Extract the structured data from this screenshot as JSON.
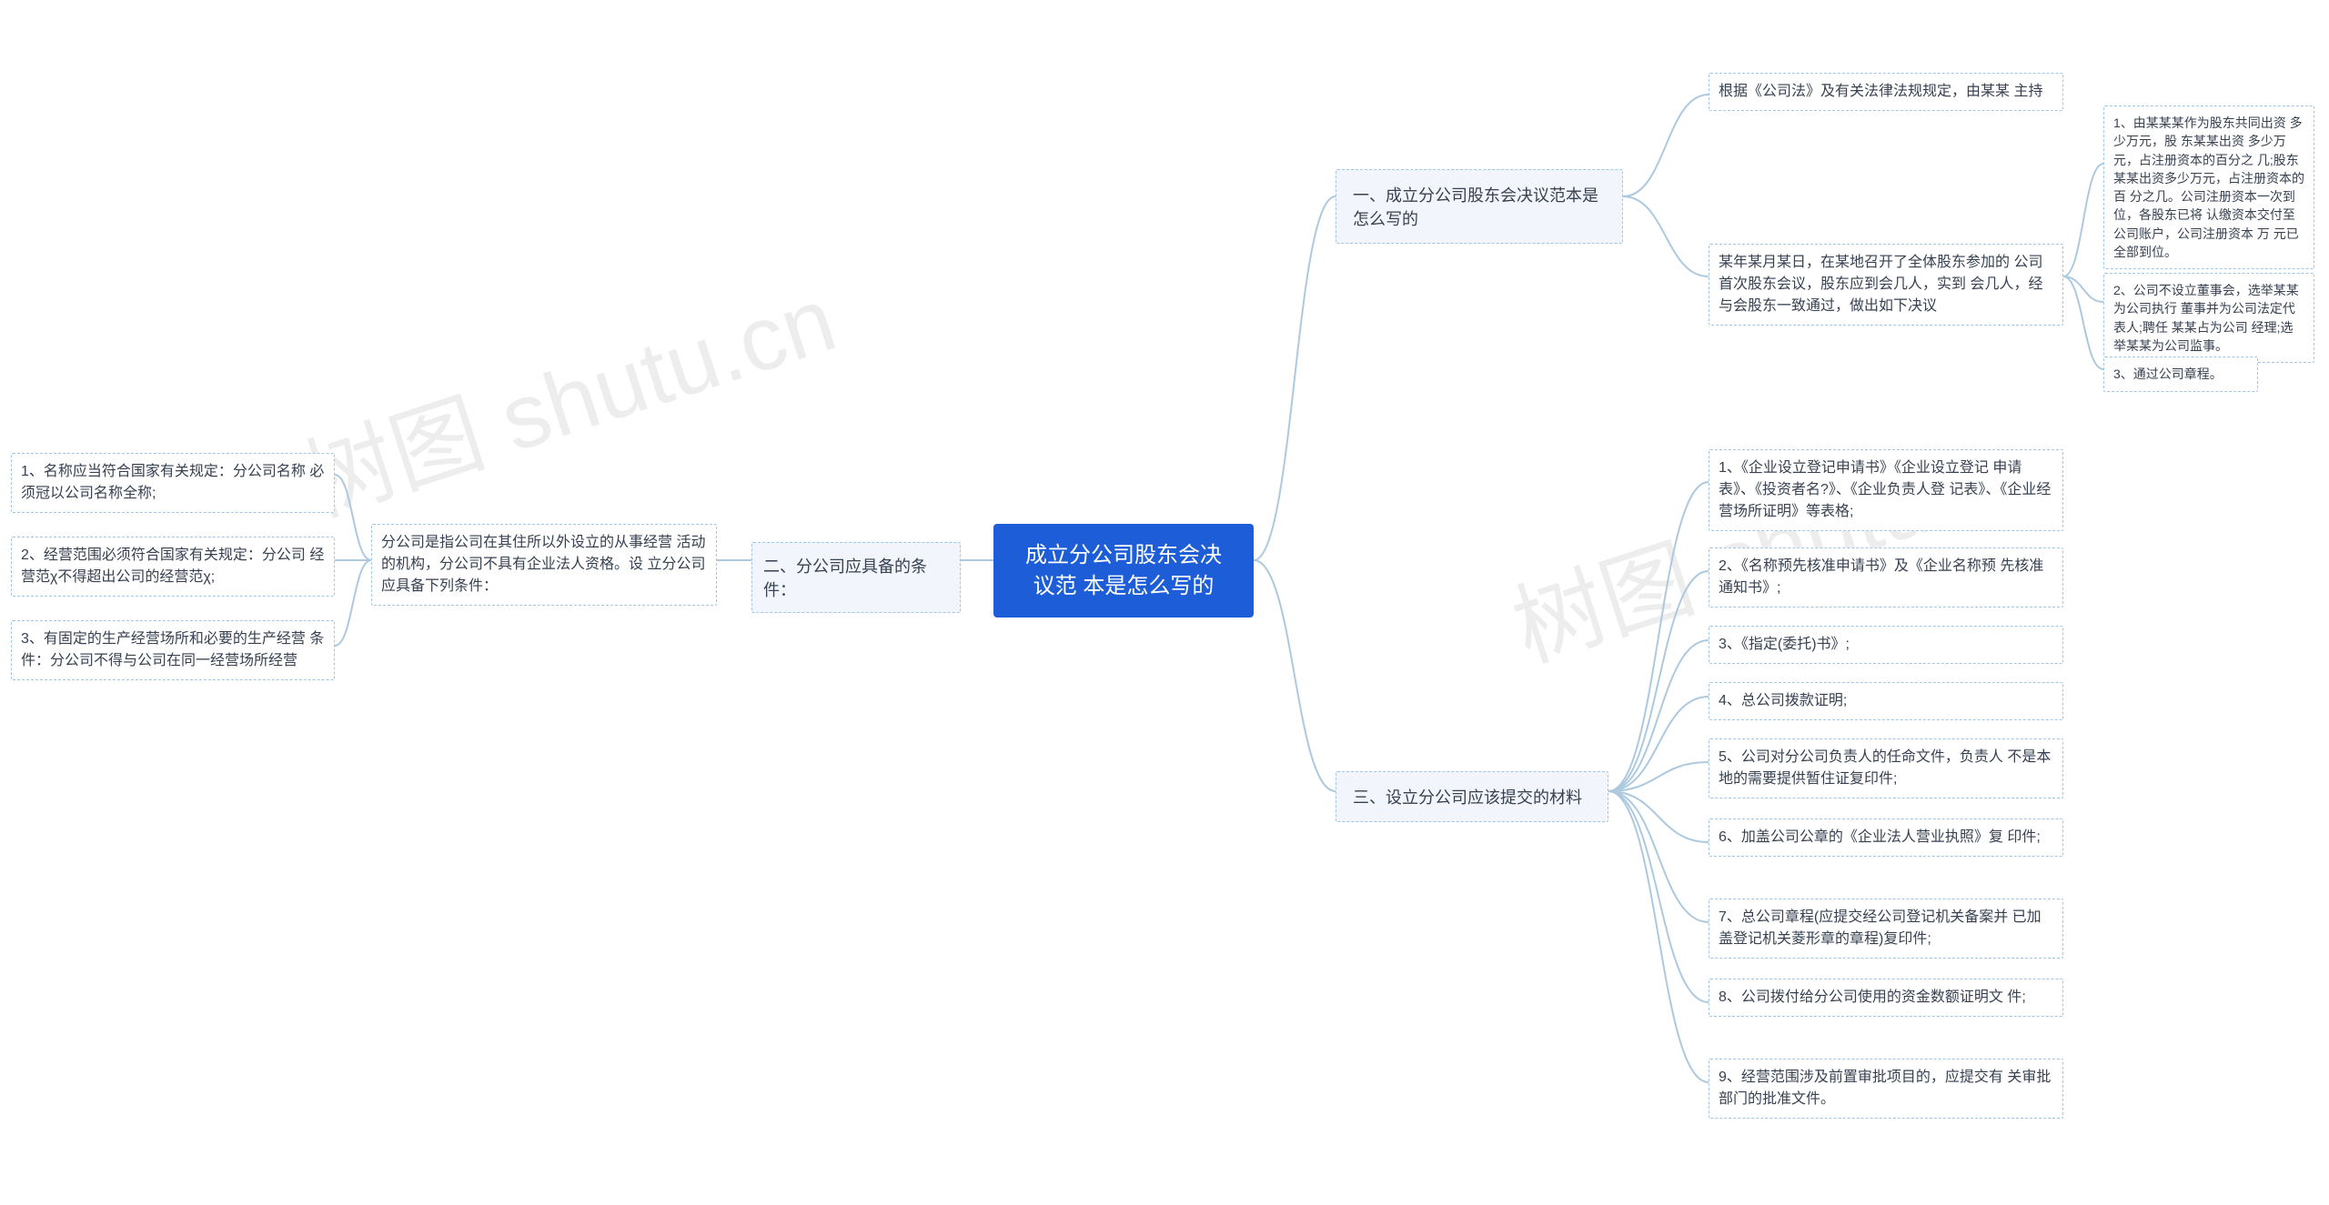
{
  "root": "成立分公司股东会决议范\n本是怎么写的",
  "b1": {
    "label": "一、成立分公司股东会决议范本是\n怎么写的",
    "c1": "根据《公司法》及有关法律法规规定，由某某\n主持",
    "c2": "某年某月某日，在某地召开了全体股东参加的\n公司首次股东会议，股东应到会几人，实到\n会几人，经与会股东一致通过，做出如下决议",
    "d1": "1、由某某某作为股东共同出资 多少万元，股\n东某某出资 多少万元，占注册资本的百分之\n几;股东某某出资多少万元，占注册资本的百\n分之几。公司注册资本一次到位，各股东已将\n认缴资本交付至公司账户，公司注册资本 万\n元已全部到位。",
    "d2": "2、公司不设立董事会，选举某某为公司执行\n董事并为公司法定代表人;聘任 某某占为公司\n经理;选举某某为公司监事。",
    "d3": "3、通过公司章程。"
  },
  "b2": {
    "label": "二、分公司应具备的条件：",
    "l1": "分公司是指公司在其住所以外设立的从事经营\n活动的机构，分公司不具有企业法人资格。设\n立分公司应具备下列条件：",
    "l2_1": "1、名称应当符合国家有关规定：分公司名称\n必须冠以公司名称全称;",
    "l2_2": "2、经营范围必须符合国家有关规定：分公司\n经营范χ不得超出公司的经营范χ;",
    "l2_3": "3、有固定的生产经营场所和必要的生产经营\n条件：分公司不得与公司在同一经营场所经营"
  },
  "b3": {
    "label": "三、设立分公司应该提交的材料",
    "m1": "1、《企业设立登记申请书》《企业设立登记\n申请表》、《投资者名?》、《企业负责人登\n记表》、《企业经营场所证明》等表格;",
    "m2": "2、《名称预先核准申请书》及《企业名称预\n先核准通知书》;",
    "m3": "3、《指定(委托)书》;",
    "m4": "4、总公司拨款证明;",
    "m5": "5、公司对分公司负责人的任命文件，负责人\n不是本地的需要提供暂住证复印件;",
    "m6": "6、加盖公司公章的《企业法人营业执照》复\n印件;",
    "m7": "7、总公司章程(应提交经公司登记机关备案并\n已加盖登记机关菱形章的章程)复印件;",
    "m8": "8、公司拨付给分公司使用的资金数额证明文\n件;",
    "m9": "9、经营范围涉及前置审批项目的，应提交有\n关审批部门的批准文件。"
  },
  "watermarks": {
    "w1": "树图 shutu.cn",
    "w2": "树图 shutu.cn"
  }
}
